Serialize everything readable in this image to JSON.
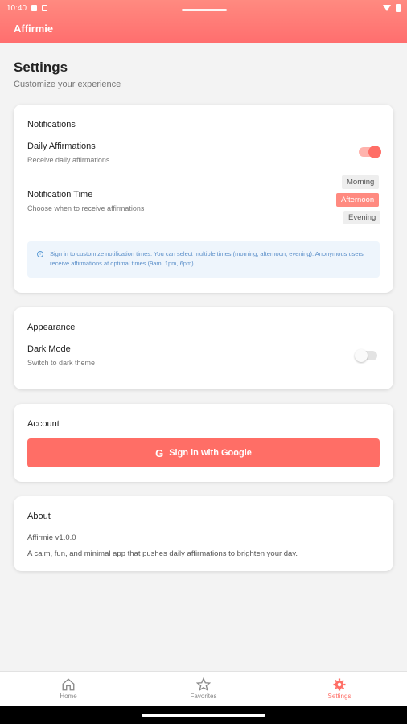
{
  "status_bar": {
    "time": "10:40"
  },
  "app": {
    "title": "Affirmie"
  },
  "page": {
    "title": "Settings",
    "subtitle": "Customize your experience"
  },
  "notifications": {
    "section_title": "Notifications",
    "daily": {
      "title": "Daily Affirmations",
      "subtitle": "Receive daily affirmations",
      "enabled": true
    },
    "time": {
      "title": "Notification Time",
      "subtitle": "Choose when to receive affirmations",
      "options": [
        {
          "label": "Morning",
          "selected": false
        },
        {
          "label": "Afternoon",
          "selected": true
        },
        {
          "label": "Evening",
          "selected": false
        }
      ]
    },
    "info_icon": "info-icon",
    "info_text": "Sign in to customize notification times. You can select multiple times (morning, afternoon, evening). Anonymous users receive affirmations at optimal times (9am, 1pm, 6pm)."
  },
  "appearance": {
    "section_title": "Appearance",
    "dark_mode": {
      "title": "Dark Mode",
      "subtitle": "Switch to dark theme",
      "enabled": false
    }
  },
  "account": {
    "section_title": "Account",
    "google_button": {
      "icon": "google-g-icon",
      "label": "Sign in with Google"
    }
  },
  "about": {
    "section_title": "About",
    "version": "Affirmie v1.0.0",
    "description": "A calm, fun, and minimal app that pushes daily affirmations to brighten your day."
  },
  "bottom_nav": [
    {
      "label": "Home",
      "icon": "home-icon",
      "active": false
    },
    {
      "label": "Favorites",
      "icon": "star-icon",
      "active": false
    },
    {
      "label": "Settings",
      "icon": "gear-icon",
      "active": true
    }
  ],
  "colors": {
    "accent": "#ff6e66",
    "header": "#ff8a80",
    "info_bg": "#eef5fc",
    "background": "#f3f3f3"
  }
}
